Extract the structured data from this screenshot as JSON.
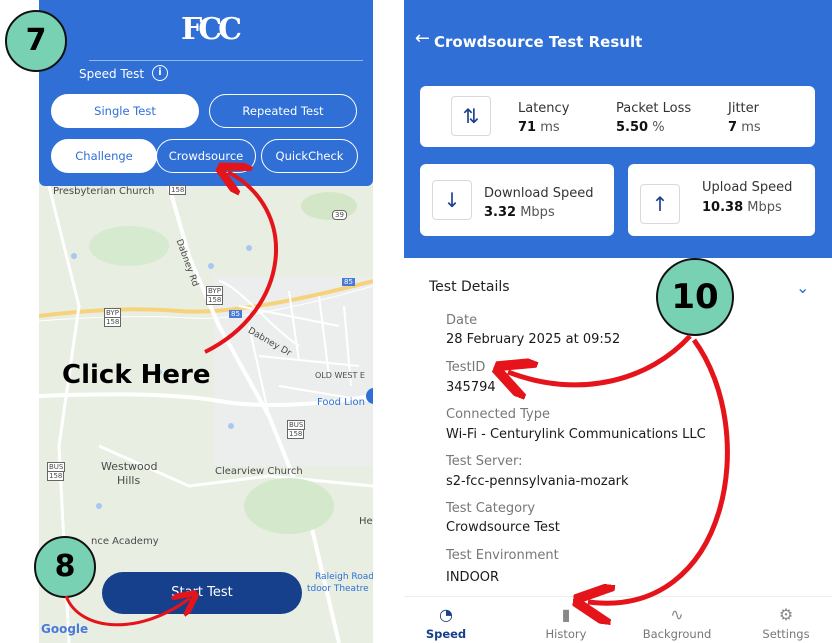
{
  "left": {
    "logo": "FCC",
    "speed_test_label": "Speed Test",
    "tabs": [
      "Single Test",
      "Repeated Test",
      "Challenge",
      "Crowdsource",
      "QuickCheck"
    ],
    "map_labels": {
      "church1": "Presbyterian Church",
      "road1": "Dabney Rd",
      "road2": "Dabney Dr",
      "oldwest": "OLD WEST E",
      "foodlion": "Food Lion",
      "westwood": "Westwood",
      "hills": "Hills",
      "clearview": "Clearview Church",
      "academy": "nce Academy",
      "raleigh": "Raleigh Road",
      "theatre": "tdoor Theatre",
      "he": "He",
      "r158a": "158",
      "r158b": "158",
      "r158c": "158",
      "r158d": "158",
      "r158e": "158",
      "r39": "39",
      "r85": "85",
      "byp": "BYP",
      "bus": "BUS"
    },
    "start_button": "Start Test",
    "google": "Google"
  },
  "annotations": {
    "step7": "7",
    "step8": "8",
    "step10": "10",
    "click_here": "Click Here",
    "arrow_color": "#e5141b",
    "badge_color": "#79d1b3"
  },
  "right": {
    "title": "Crowdsource Test Result",
    "latency_label": "Latency",
    "latency_value": "71",
    "latency_unit": "ms",
    "packet_loss_label": "Packet Loss",
    "packet_loss_value": "5.50",
    "packet_loss_unit": "%",
    "jitter_label": "Jitter",
    "jitter_value": "7",
    "jitter_unit": "ms",
    "download_label": "Download Speed",
    "download_value": "3.32",
    "download_unit": "Mbps",
    "upload_label": "Upload Speed",
    "upload_value": "10.38",
    "upload_unit": "Mbps",
    "details_title": "Test Details",
    "details": [
      {
        "label": "Date",
        "value": "28 February 2025 at 09:52"
      },
      {
        "label": "TestID",
        "value": "345794"
      },
      {
        "label": "Connected Type",
        "value": "Wi-Fi - Centurylink Communications LLC"
      },
      {
        "label": "Test Server:",
        "value": "s2-fcc-pennsylvania-mozark"
      },
      {
        "label": "Test Category",
        "value": "Crowdsource Test"
      },
      {
        "label": "Test Environment",
        "value": "INDOOR"
      }
    ],
    "nav": [
      "Speed",
      "History",
      "Background",
      "Settings"
    ]
  }
}
